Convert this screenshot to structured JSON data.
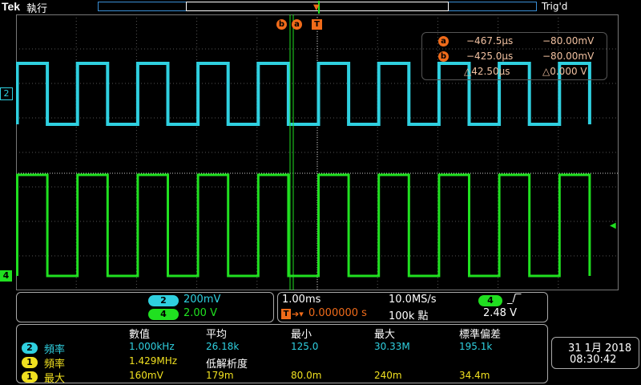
{
  "header": {
    "brand": "Tek",
    "mode": "執行",
    "trigger_status": "Trig'd"
  },
  "markers": {
    "cursor_b": "b",
    "cursor_a": "a",
    "trigger": "T",
    "ch2": "2",
    "ch4": "4"
  },
  "cursor_readout": {
    "a_label": "a",
    "a_time": "−467.5µs",
    "a_volt": "−80.00mV",
    "b_label": "b",
    "b_time": "−425.0µs",
    "b_volt": "−80.00mV",
    "delta_time": "△42.50µs",
    "delta_volt": "△0.000 V"
  },
  "channels": {
    "ch2_num": "2",
    "ch2_scale": "200mV",
    "ch4_num": "4",
    "ch4_scale": "2.00 V"
  },
  "timebase": {
    "scale": "1.00ms",
    "sample_rate": "10.0MS/s",
    "trig_pos_label": "T",
    "trig_delay": "0.000000 s",
    "record_length": "100k 點",
    "trig_source": "4",
    "trig_slope": "⎍",
    "trig_level": "2.48 V"
  },
  "measurements": {
    "headers": [
      "數值",
      "平均",
      "最小",
      "最大",
      "標準偏差"
    ],
    "rows": [
      {
        "ch": "2",
        "name": "頻率",
        "value": "1.000kHz",
        "mean": "26.18k",
        "min": "125.0",
        "max": "30.33M",
        "std": "195.1k"
      },
      {
        "ch": "1",
        "name": "頻率",
        "value": "1.429MHz",
        "mean": "低解析度",
        "min": "",
        "max": "",
        "std": ""
      },
      {
        "ch": "1",
        "name": "最大",
        "value": "160mV",
        "mean": "179m",
        "min": "80.0m",
        "max": "240m",
        "std": "34.4m"
      }
    ]
  },
  "datetime": {
    "date": "31 1月 2018",
    "time": "08:30:42"
  },
  "colors": {
    "ch2": "#2fd0e0",
    "ch4": "#20e020",
    "ch1": "#f0e020",
    "cursor": "#f06b1a",
    "grid": "#555"
  }
}
